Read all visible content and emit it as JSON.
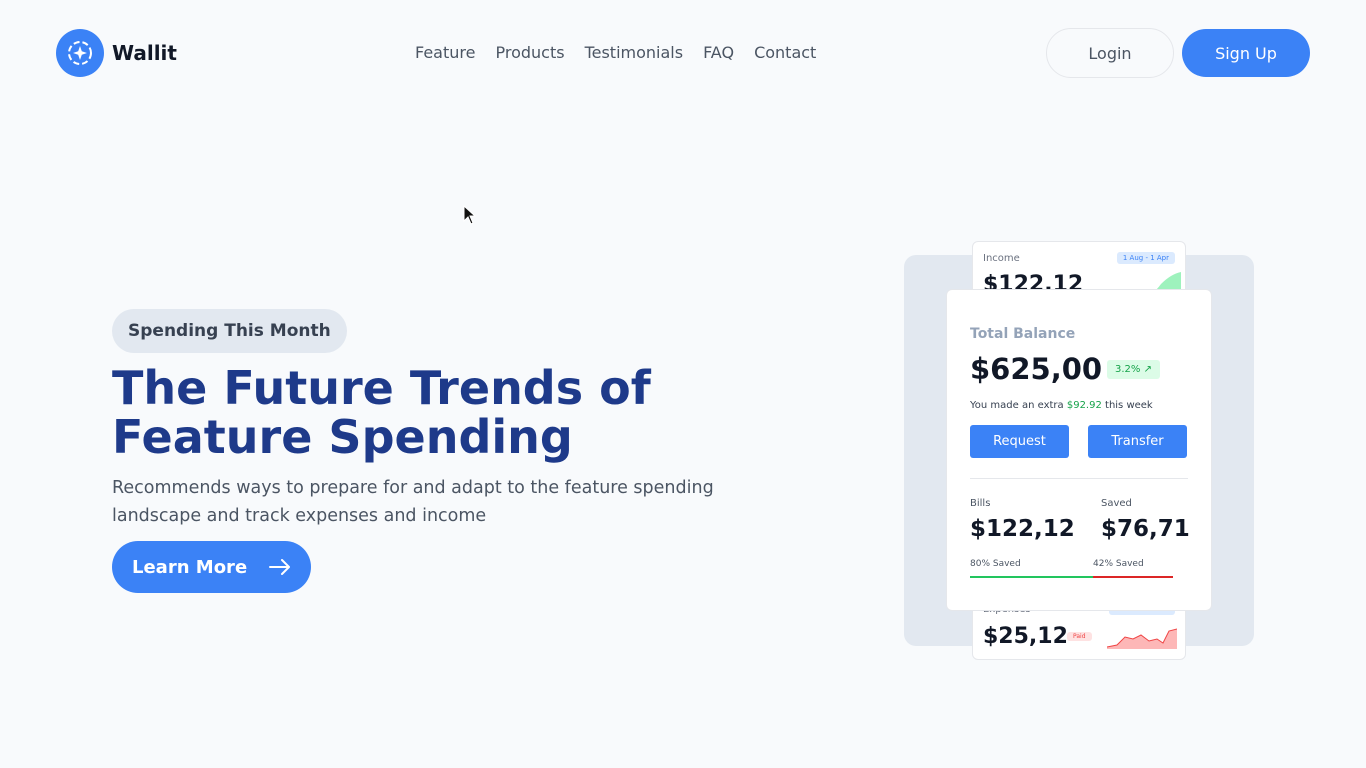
{
  "brand": {
    "name": "Wallit"
  },
  "nav": [
    "Feature",
    "Products",
    "Testimonials",
    "FAQ",
    "Contact"
  ],
  "auth": {
    "login": "Login",
    "signup": "Sign Up"
  },
  "hero": {
    "pill": "Spending This Month",
    "title": "The Future Trends of Feature Spending",
    "description": "Recommends ways to prepare for and adapt to the feature spending landscape and track expenses and income",
    "cta": "Learn More"
  },
  "card": {
    "income_label": "Income",
    "income_range": "1 Aug - 1 Apr",
    "income_amount": "$122,12",
    "total_label": "Total Balance",
    "total_amount": "$625,00",
    "growth": "3.2%",
    "extra_prefix": "You made an extra ",
    "extra_value": "$92.92",
    "extra_suffix": " this week",
    "request": "Request",
    "transfer": "Transfer",
    "bills_label": "Bills",
    "bills_amount": "$122,12",
    "bills_saved": "80% Saved",
    "saved_label": "Saved",
    "saved_amount": "$76,71",
    "saved_saved": "42% Saved",
    "expenses_label": "Expenses",
    "expenses_amount": "$25,12",
    "paid": "Paid"
  },
  "colors": {
    "accent": "#3b82f6",
    "title": "#1e3a8a",
    "positive": "#16a34a",
    "negative": "#dc2626"
  }
}
